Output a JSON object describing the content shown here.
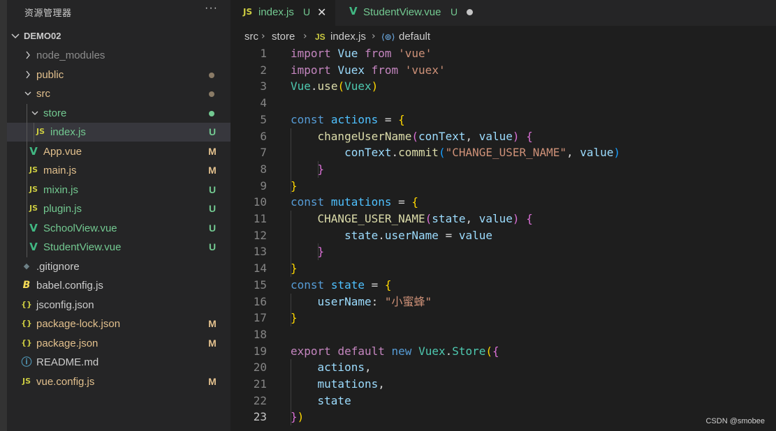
{
  "colors": {
    "accent_green": "#73c991",
    "modified_yellow": "#e2c08d",
    "js_yellow": "#cbcb41",
    "vue_green": "#41b883",
    "dot_gray": "#8a7b66",
    "dot_green": "#73c991"
  },
  "sidebar": {
    "title": "资源管理器",
    "more_icon": "ellipsis-icon",
    "more_label": "···",
    "project": "DEMO02",
    "items": [
      {
        "label": "node_modules",
        "type": "folder-collapsed",
        "status": "",
        "icon": "chevron-right-icon"
      },
      {
        "label": "public",
        "type": "folder-collapsed",
        "status": "dot",
        "icon": "chevron-right-icon"
      },
      {
        "label": "src",
        "type": "folder-open",
        "status": "dot",
        "icon": "chevron-down-icon"
      },
      {
        "label": "store",
        "type": "folder-open",
        "status": "dot-green",
        "icon": "chevron-down-icon"
      },
      {
        "label": "index.js",
        "type": "js",
        "status": "U",
        "icon": "js-icon",
        "icon_text": "JS"
      },
      {
        "label": "App.vue",
        "type": "vue",
        "status": "M",
        "icon": "vue-icon",
        "icon_text": "V"
      },
      {
        "label": "main.js",
        "type": "js",
        "status": "M",
        "icon": "js-icon",
        "icon_text": "JS"
      },
      {
        "label": "mixin.js",
        "type": "js",
        "status": "U",
        "icon": "js-icon",
        "icon_text": "JS"
      },
      {
        "label": "plugin.js",
        "type": "js",
        "status": "U",
        "icon": "js-icon",
        "icon_text": "JS"
      },
      {
        "label": "SchoolView.vue",
        "type": "vue",
        "status": "U",
        "icon": "vue-icon",
        "icon_text": "V"
      },
      {
        "label": "StudentView.vue",
        "type": "vue",
        "status": "U",
        "icon": "vue-icon",
        "icon_text": "V"
      },
      {
        "label": ".gitignore",
        "type": "git",
        "status": "",
        "icon": "git-icon",
        "icon_text": "◆"
      },
      {
        "label": "babel.config.js",
        "type": "babel",
        "status": "",
        "icon": "babel-icon",
        "icon_text": "B"
      },
      {
        "label": "jsconfig.json",
        "type": "json",
        "status": "",
        "icon": "json-icon",
        "icon_text": "{}"
      },
      {
        "label": "package-lock.json",
        "type": "json",
        "status": "M",
        "icon": "json-icon",
        "icon_text": "{}"
      },
      {
        "label": "package.json",
        "type": "json",
        "status": "M",
        "icon": "json-icon",
        "icon_text": "{}"
      },
      {
        "label": "README.md",
        "type": "info",
        "status": "",
        "icon": "info-icon",
        "icon_text": "ⓘ"
      },
      {
        "label": "vue.config.js",
        "type": "js",
        "status": "M",
        "icon": "js-icon",
        "icon_text": "JS"
      }
    ]
  },
  "tabs": [
    {
      "label": "index.js",
      "status": "U",
      "icon_text": "JS",
      "close": "✕"
    },
    {
      "label": "StudentView.vue",
      "status": "U",
      "icon_text": "V"
    }
  ],
  "breadcrumb": {
    "parts": [
      "src",
      "store",
      "index.js",
      "default"
    ],
    "js_badge": "JS",
    "symbol_badge": "⟨⊚⟩"
  },
  "code_lines": [
    [
      [
        "kw",
        "import"
      ],
      [
        "p",
        " "
      ],
      [
        "var",
        "Vue"
      ],
      [
        "p",
        " "
      ],
      [
        "kw",
        "from"
      ],
      [
        "p",
        " "
      ],
      [
        "str",
        "'vue'"
      ]
    ],
    [
      [
        "kw",
        "import"
      ],
      [
        "p",
        " "
      ],
      [
        "var",
        "Vuex"
      ],
      [
        "p",
        " "
      ],
      [
        "kw",
        "from"
      ],
      [
        "p",
        " "
      ],
      [
        "str",
        "'vuex'"
      ]
    ],
    [
      [
        "cls",
        "Vue"
      ],
      [
        "p",
        "."
      ],
      [
        "fn",
        "use"
      ],
      [
        "b1",
        "("
      ],
      [
        "cls",
        "Vuex"
      ],
      [
        "b1",
        ")"
      ]
    ],
    [],
    [
      [
        "kw2",
        "const"
      ],
      [
        "p",
        " "
      ],
      [
        "const",
        "actions"
      ],
      [
        "p",
        " = "
      ],
      [
        "b1",
        "{"
      ]
    ],
    [
      [
        "p",
        "    "
      ],
      [
        "fn",
        "changeUserName"
      ],
      [
        "b2",
        "("
      ],
      [
        "var",
        "conText"
      ],
      [
        "p",
        ", "
      ],
      [
        "var",
        "value"
      ],
      [
        "b2",
        ")"
      ],
      [
        "p",
        " "
      ],
      [
        "b2",
        "{"
      ]
    ],
    [
      [
        "p",
        "        "
      ],
      [
        "var",
        "conText"
      ],
      [
        "p",
        "."
      ],
      [
        "fn",
        "commit"
      ],
      [
        "b3",
        "("
      ],
      [
        "str",
        "\"CHANGE_USER_NAME\""
      ],
      [
        "p",
        ", "
      ],
      [
        "var",
        "value"
      ],
      [
        "b3",
        ")"
      ]
    ],
    [
      [
        "p",
        "    "
      ],
      [
        "b2",
        "}"
      ]
    ],
    [
      [
        "b1",
        "}"
      ]
    ],
    [
      [
        "kw2",
        "const"
      ],
      [
        "p",
        " "
      ],
      [
        "const",
        "mutations"
      ],
      [
        "p",
        " = "
      ],
      [
        "b1",
        "{"
      ]
    ],
    [
      [
        "p",
        "    "
      ],
      [
        "fn",
        "CHANGE_USER_NAME"
      ],
      [
        "b2",
        "("
      ],
      [
        "var",
        "state"
      ],
      [
        "p",
        ", "
      ],
      [
        "var",
        "value"
      ],
      [
        "b2",
        ")"
      ],
      [
        "p",
        " "
      ],
      [
        "b2",
        "{"
      ]
    ],
    [
      [
        "p",
        "        "
      ],
      [
        "var",
        "state"
      ],
      [
        "p",
        "."
      ],
      [
        "var",
        "userName"
      ],
      [
        "p",
        " = "
      ],
      [
        "var",
        "value"
      ]
    ],
    [
      [
        "p",
        "    "
      ],
      [
        "b2",
        "}"
      ]
    ],
    [
      [
        "b1",
        "}"
      ]
    ],
    [
      [
        "kw2",
        "const"
      ],
      [
        "p",
        " "
      ],
      [
        "const",
        "state"
      ],
      [
        "p",
        " = "
      ],
      [
        "b1",
        "{"
      ]
    ],
    [
      [
        "p",
        "    "
      ],
      [
        "var",
        "userName"
      ],
      [
        "p",
        ": "
      ],
      [
        "str",
        "\"小蜜蜂\""
      ]
    ],
    [
      [
        "b1",
        "}"
      ]
    ],
    [],
    [
      [
        "kw",
        "export"
      ],
      [
        "p",
        " "
      ],
      [
        "kw",
        "default"
      ],
      [
        "p",
        " "
      ],
      [
        "kw2",
        "new"
      ],
      [
        "p",
        " "
      ],
      [
        "cls",
        "Vuex"
      ],
      [
        "p",
        "."
      ],
      [
        "cls",
        "Store"
      ],
      [
        "b1",
        "("
      ],
      [
        "b2",
        "{"
      ]
    ],
    [
      [
        "p",
        "    "
      ],
      [
        "var",
        "actions"
      ],
      [
        "p",
        ","
      ]
    ],
    [
      [
        "p",
        "    "
      ],
      [
        "var",
        "mutations"
      ],
      [
        "p",
        ","
      ]
    ],
    [
      [
        "p",
        "    "
      ],
      [
        "var",
        "state"
      ]
    ],
    [
      [
        "b2",
        "}"
      ],
      [
        "b1",
        ")"
      ]
    ]
  ],
  "current_line": 23,
  "watermark": "CSDN @smobee"
}
